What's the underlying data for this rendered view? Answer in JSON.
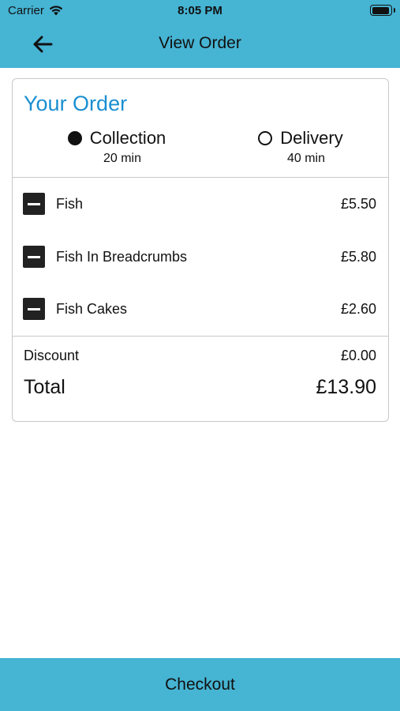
{
  "status_bar": {
    "carrier": "Carrier",
    "time": "8:05 PM",
    "battery_level": 0.95
  },
  "nav": {
    "back_icon": "arrow-left-icon",
    "title": "View Order"
  },
  "order": {
    "title": "Your Order",
    "options": [
      {
        "label": "Collection",
        "time": "20 min",
        "selected": true
      },
      {
        "label": "Delivery",
        "time": "40 min",
        "selected": false
      }
    ],
    "items": [
      {
        "name": "Fish",
        "price": "£5.50"
      },
      {
        "name": "Fish In Breadcrumbs",
        "price": "£5.80"
      },
      {
        "name": "Fish Cakes",
        "price": "£2.60"
      }
    ],
    "discount_label": "Discount",
    "discount_value": "£0.00",
    "total_label": "Total",
    "total_value": "£13.90"
  },
  "checkout": {
    "label": "Checkout"
  },
  "colors": {
    "accent": "#46b4d3",
    "title": "#1a8fd1"
  }
}
